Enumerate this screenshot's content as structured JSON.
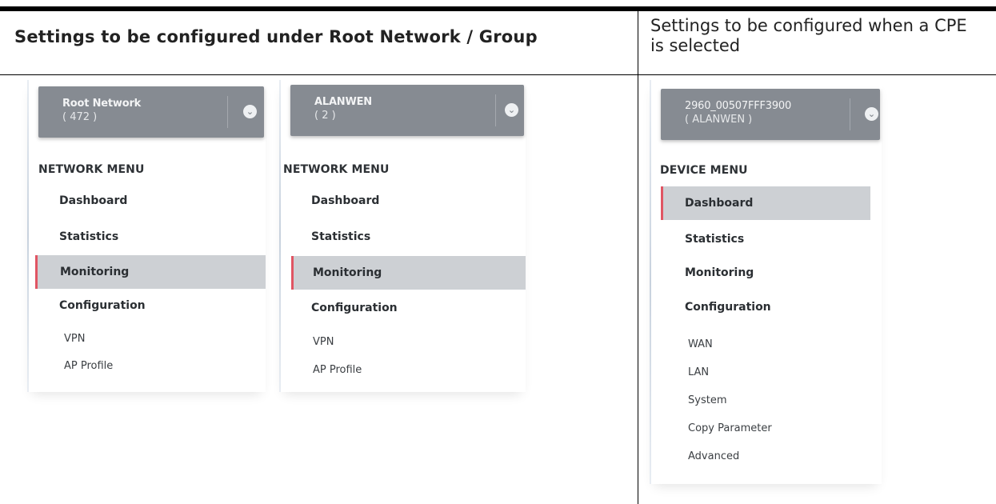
{
  "table": {
    "header_left": "Settings to be configured under Root Network / Group",
    "header_right": "Settings to be configured when a CPE is selected"
  },
  "panels": [
    {
      "selector": {
        "name": "Root Network",
        "count": "( 472 )"
      },
      "menu_heading": "NETWORK MENU",
      "items": [
        "Dashboard",
        "Statistics",
        "Monitoring",
        "Configuration"
      ],
      "active_item": "Monitoring",
      "sub_items": [
        "VPN",
        "AP Profile"
      ]
    },
    {
      "selector": {
        "name": "ALANWEN",
        "count": "( 2 )"
      },
      "menu_heading": "NETWORK MENU",
      "items": [
        "Dashboard",
        "Statistics",
        "Monitoring",
        "Configuration"
      ],
      "active_item": "Monitoring",
      "sub_items": [
        "VPN",
        "AP Profile"
      ]
    },
    {
      "selector": {
        "name": "2960_00507FFF3900",
        "count": "( ALANWEN )"
      },
      "menu_heading": "DEVICE MENU",
      "items": [
        "Dashboard",
        "Statistics",
        "Monitoring",
        "Configuration"
      ],
      "active_item": "Dashboard",
      "sub_items": [
        "WAN",
        "LAN",
        "System",
        "Copy Parameter",
        "Advanced"
      ]
    }
  ],
  "icons": {
    "selector_toggle": "chevron-down-circle-icon"
  },
  "colors": {
    "selector_bg": "#868b92",
    "active_bg": "#cdd0d4",
    "active_marker": "#e05563"
  }
}
